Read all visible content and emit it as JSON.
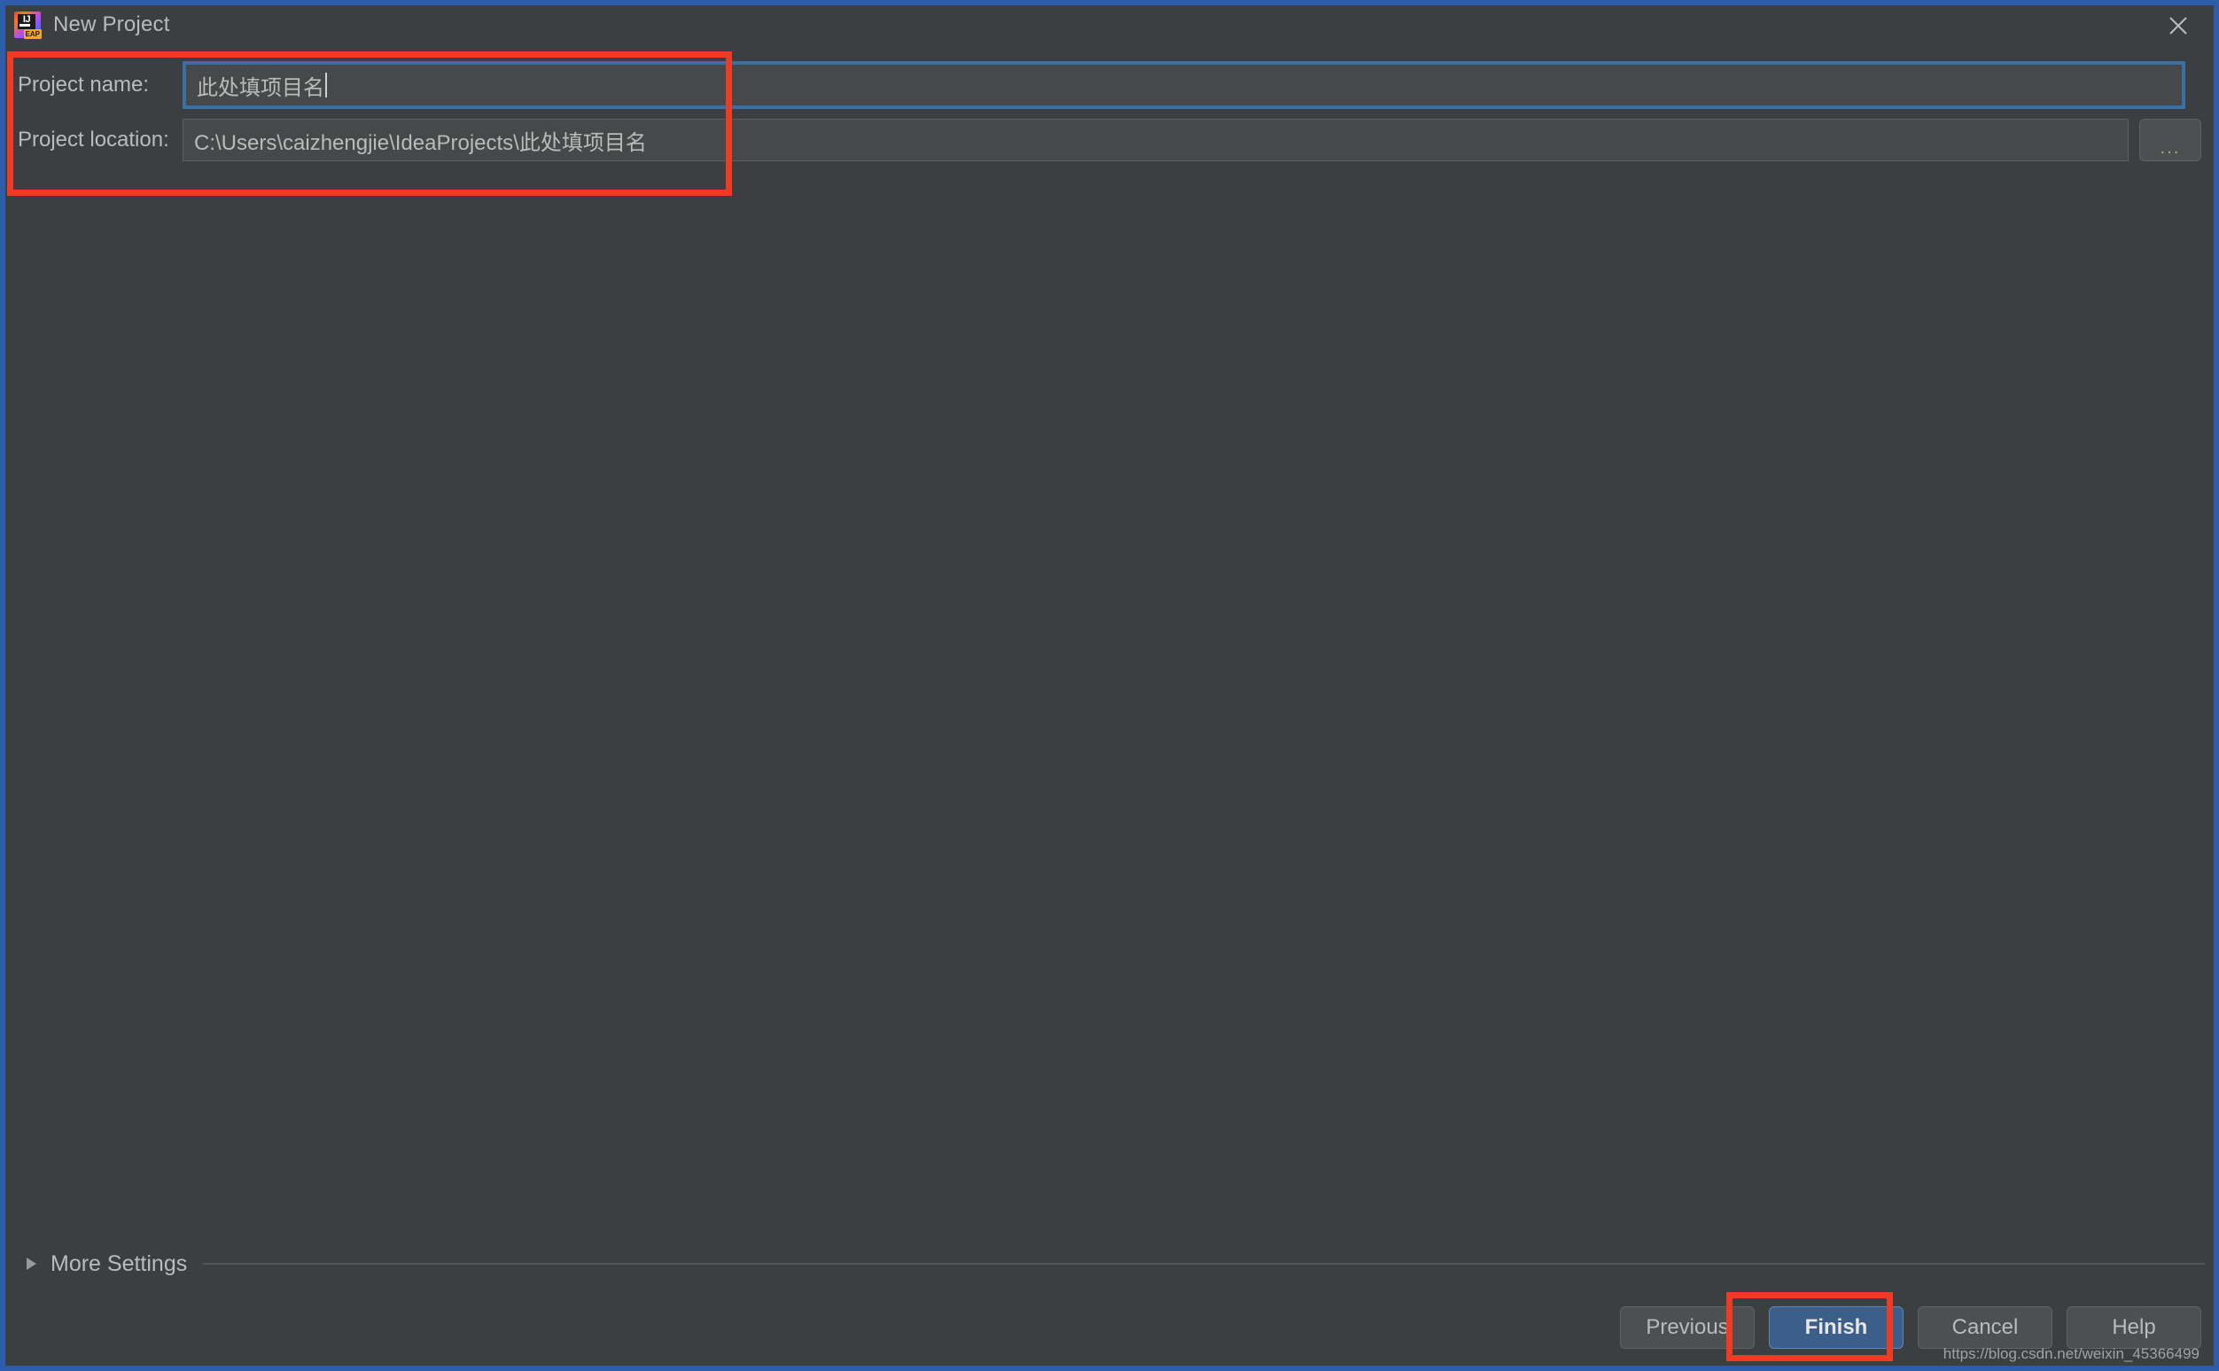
{
  "window": {
    "title": "New Project",
    "app_icon": "intellij-idea-eap-icon",
    "icon_text": "IJ",
    "icon_badge": "EAP",
    "close_icon": "close-icon",
    "border_color": "#2d5ca8",
    "background_color": "#3c3f41"
  },
  "form": {
    "project_name": {
      "label": "Project name:",
      "value": "此处填项目名",
      "focused": true,
      "focus_border_color": "#3b6ea5"
    },
    "project_location": {
      "label": "Project location:",
      "value": "C:\\Users\\caizhengjie\\IdeaProjects\\此处填项目名",
      "browse_label": "...",
      "browse_icon": "ellipsis-icon"
    }
  },
  "more_settings": {
    "label": "More Settings",
    "expanded": false,
    "chevron_icon": "triangle-right-icon"
  },
  "footer": {
    "buttons": [
      {
        "label": "Previous",
        "primary": false
      },
      {
        "label": "Finish",
        "primary": true
      },
      {
        "label": "Cancel",
        "primary": false
      },
      {
        "label": "Help",
        "primary": false
      }
    ]
  },
  "annotations": {
    "color": "#ef3b24",
    "fields_box": "highlight around project name and location fields",
    "finish_box": "highlight around Finish button"
  },
  "watermark": "https://blog.csdn.net/weixin_45366499"
}
